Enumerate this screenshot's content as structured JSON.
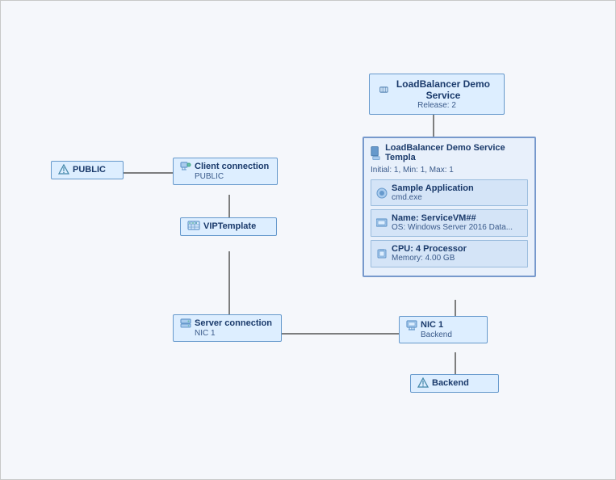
{
  "nodes": {
    "loadbalancer_service": {
      "title": "LoadBalancer Demo Service",
      "subtitle": "Release: 2"
    },
    "template": {
      "title": "LoadBalancer Demo Service Templa",
      "subtitle": "Initial: 1, Min: 1, Max: 1",
      "section_app": {
        "name": "Sample Application",
        "sub": "cmd.exe"
      },
      "section_vm": {
        "name": "Name: ServiceVM##",
        "sub": "OS:    Windows Server 2016 Data..."
      },
      "section_cpu": {
        "cpu": "CPU:    4 Processor",
        "memory": "Memory: 4.00 GB"
      }
    },
    "public": {
      "label": "PUBLIC"
    },
    "client_connection": {
      "label": "Client connection",
      "sublabel": "PUBLIC"
    },
    "vip_template": {
      "label": "VIPTemplate"
    },
    "server_connection": {
      "label": "Server connection",
      "sublabel": "NIC 1"
    },
    "nic1": {
      "label": "NIC 1",
      "sublabel": "Backend"
    },
    "backend": {
      "label": "Backend"
    }
  },
  "colors": {
    "box_bg": "#ddeeff",
    "box_border": "#6699cc",
    "template_bg": "#e8f0fb",
    "template_border": "#7799cc",
    "section_bg": "#d4e4f7",
    "section_border": "#99bbdd",
    "line_color": "#555555",
    "text_dark": "#1a3a6b",
    "text_mid": "#3a5a8a"
  }
}
